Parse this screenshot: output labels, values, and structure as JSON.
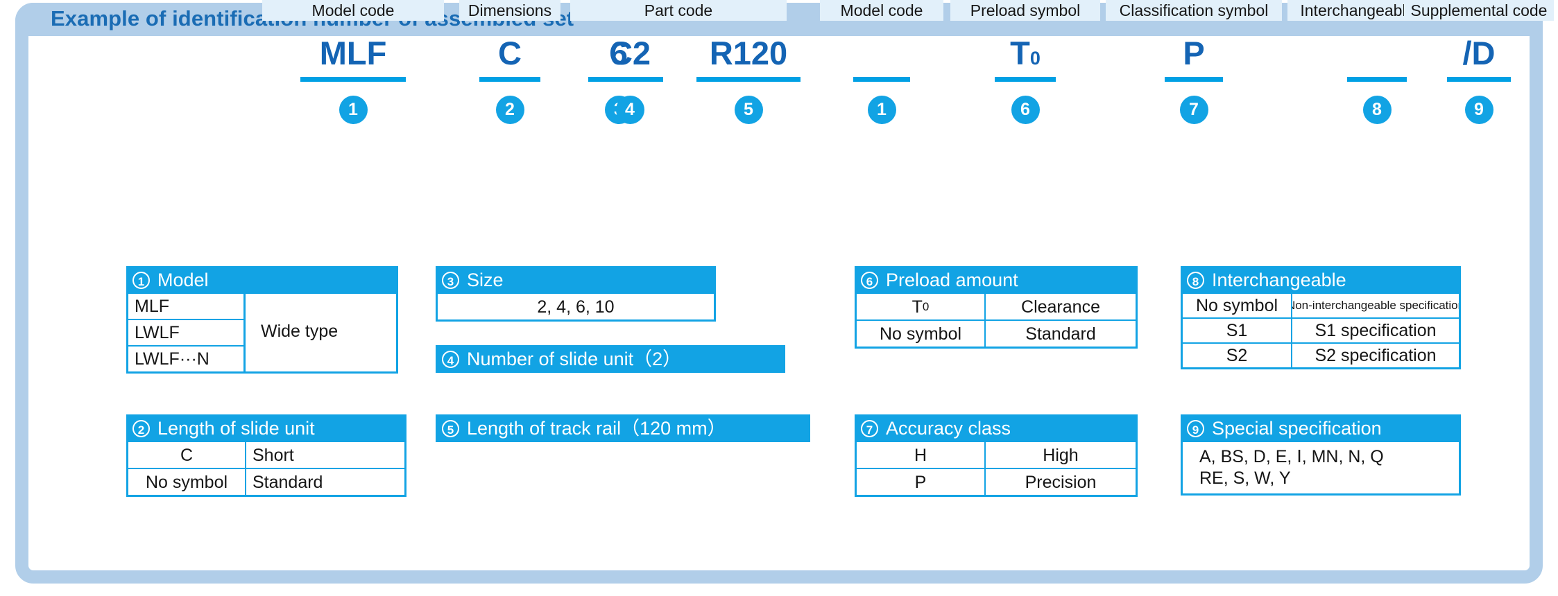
{
  "header": {
    "title": "Example of identification number of assembled set"
  },
  "code_row": {
    "segments": [
      {
        "label": "Model code",
        "code": "MLF",
        "number": "1"
      },
      {
        "label": "Dimensions",
        "code": "C",
        "number": "2"
      },
      {
        "label": "",
        "code": "6",
        "number": "3"
      },
      {
        "label": "Part code",
        "code": "C2",
        "number": "4"
      },
      {
        "label": "",
        "code": "R120",
        "number": "5"
      },
      {
        "label": "Model code",
        "code": "",
        "number": "1"
      },
      {
        "label": "Preload symbol",
        "code": "T",
        "code_sub": "0",
        "number": "6"
      },
      {
        "label": "Classification symbol",
        "code": "P",
        "number": "7"
      },
      {
        "label": "Interchangeable code",
        "code": "",
        "number": "8"
      },
      {
        "label": "Supplemental code",
        "code": "/D",
        "number": "9"
      }
    ]
  },
  "tables": {
    "model": {
      "number": "1",
      "title": "Model",
      "rows": [
        {
          "symbol": "MLF"
        },
        {
          "symbol": "LWLF"
        },
        {
          "symbol": "LWLF···N"
        }
      ],
      "merged_value": "Wide type"
    },
    "length_of_slide_unit": {
      "number": "2",
      "title": "Length of slide unit",
      "rows": [
        {
          "symbol": "C",
          "value": "Short"
        },
        {
          "symbol": "No symbol",
          "value": "Standard"
        }
      ]
    },
    "size": {
      "number": "3",
      "title": "Size",
      "value": "2, 4, 6, 10"
    },
    "number_of_slide_unit": {
      "number": "4",
      "title": "Number of slide unit（2）"
    },
    "length_of_track_rail": {
      "number": "5",
      "title": "Length of track rail（120 mm）"
    },
    "preload_amount": {
      "number": "6",
      "title": "Preload amount",
      "rows": [
        {
          "symbol": "T",
          "symbol_sub": "0",
          "value": "Clearance"
        },
        {
          "symbol": "No symbol",
          "value": "Standard"
        }
      ]
    },
    "accuracy_class": {
      "number": "7",
      "title": "Accuracy class",
      "rows": [
        {
          "symbol": "H",
          "value": "High"
        },
        {
          "symbol": "P",
          "value": "Precision"
        }
      ]
    },
    "interchangeable": {
      "number": "8",
      "title": "Interchangeable",
      "rows": [
        {
          "symbol": "No symbol",
          "value": "Non-interchangeable specification"
        },
        {
          "symbol": "S1",
          "value": "S1 specification"
        },
        {
          "symbol": "S2",
          "value": "S2 specification"
        }
      ]
    },
    "special_specification": {
      "number": "9",
      "title": "Special specification",
      "line1_a": "A, BS, D, E,",
      "line1_roman": "Ⅰ",
      "line1_b": ", MN, N, Q",
      "line2": "RE, S, W, Y"
    }
  },
  "colors": {
    "frame": "#b1cee9",
    "accent": "#12a3e4",
    "code_text": "#1464b4",
    "label_bg": "#e2f0fa",
    "title_text": "#1a6cb4"
  }
}
